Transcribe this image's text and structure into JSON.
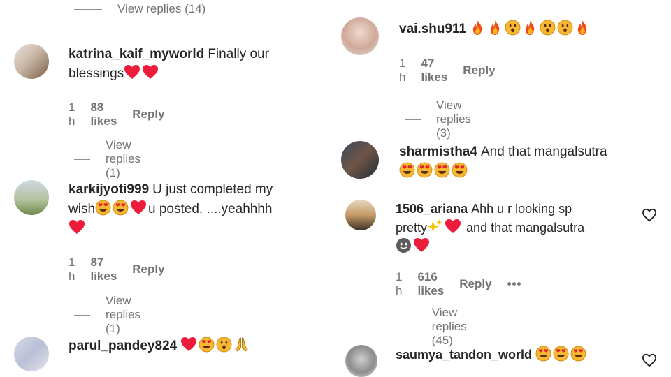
{
  "left": {
    "top_view_replies": "View replies (14)",
    "comments": [
      {
        "user": "katrina_kaif_myworld",
        "text_1": "Finally our",
        "text_2": "blessings",
        "time": "1 h",
        "likes": "88 likes",
        "reply": "Reply",
        "view_replies": "View replies (1)"
      },
      {
        "user": "karkijyoti999",
        "text_1": "U just completed my",
        "text_2a": "wish",
        "text_2b": "u posted. ....yeahhhh",
        "time": "1 h",
        "likes": "87 likes",
        "reply": "Reply",
        "view_replies": "View replies (1)"
      },
      {
        "user": "parul_pandey824"
      }
    ]
  },
  "right": {
    "comments": [
      {
        "user": "vai.shu911",
        "time": "1 h",
        "likes": "47 likes",
        "reply": "Reply",
        "view_replies": "View replies (3)"
      },
      {
        "user": "sharmistha4",
        "text_1": "And that mangalsutra"
      },
      {
        "user": "1506_ariana",
        "text_1": "Ahh u r looking sp",
        "text_2a": "pretty",
        "text_2b": "and that mangalsutra",
        "time": "1 h",
        "likes": "616 likes",
        "reply": "Reply",
        "more": "•••",
        "view_replies": "View replies (45)"
      },
      {
        "user": "saumya_tandon_world"
      }
    ]
  },
  "icons": {
    "heart": "red-heart-icon",
    "fire": "fire-emoji-icon",
    "heart_eyes": "heart-eyes-emoji-icon",
    "surprised": "surprised-emoji-icon",
    "praying": "folded-hands-emoji-icon",
    "sparkles": "sparkles-emoji-icon",
    "like": "like-heart-outline-icon"
  },
  "colors": {
    "text": "#262626",
    "meta": "#737373",
    "heart": "#ed1c3a",
    "emoji": "#f7b733"
  }
}
